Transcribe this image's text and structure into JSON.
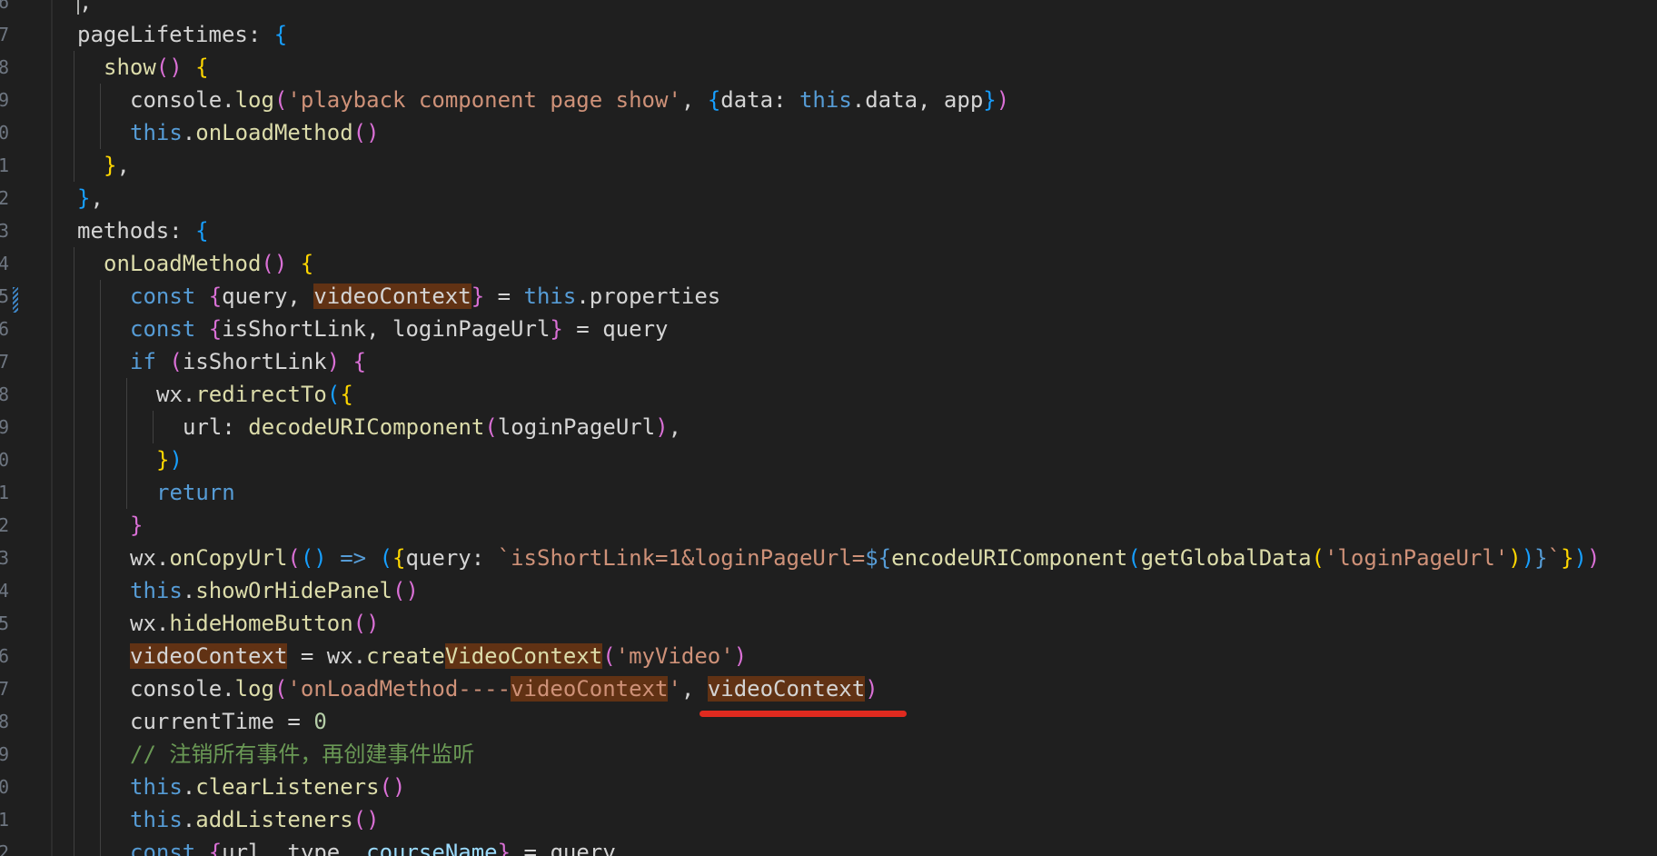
{
  "editor": {
    "language": "javascript",
    "highlight_color": "#613214",
    "annotation_color": "#e02a1f",
    "highlighted_identifier": "videoContext"
  },
  "gutter": {
    "line_number_fragments": [
      "6",
      "7",
      "8",
      "9",
      "0",
      "1",
      "2",
      "3",
      "4",
      "5",
      "6",
      "7",
      "8",
      "9",
      "0",
      "1",
      "2",
      "3",
      "4",
      "5",
      "6",
      "7",
      "8",
      "9",
      "0",
      "1",
      "2"
    ]
  },
  "lines": [
    {
      "t": [
        [
          "cursor",
          ""
        ],
        [
          "p",
          ","
        ]
      ]
    },
    {
      "t": [
        [
          "n",
          "pageLifetimes"
        ],
        [
          "p",
          ": "
        ],
        [
          "b3",
          "{"
        ]
      ]
    },
    {
      "t": [
        [
          "f",
          "show"
        ],
        [
          "b2",
          "()"
        ],
        [
          "p",
          " "
        ],
        [
          "b1",
          "{"
        ]
      ]
    },
    {
      "t": [
        [
          "n",
          "console"
        ],
        [
          "p",
          "."
        ],
        [
          "f",
          "log"
        ],
        [
          "b2",
          "("
        ],
        [
          "s",
          "'playback component page show'"
        ],
        [
          "p",
          ", "
        ],
        [
          "b3",
          "{"
        ],
        [
          "n",
          "data"
        ],
        [
          "p",
          ": "
        ],
        [
          "k",
          "this"
        ],
        [
          "p",
          "."
        ],
        [
          "n",
          "data"
        ],
        [
          "p",
          ", "
        ],
        [
          "n",
          "app"
        ],
        [
          "b3",
          "}"
        ],
        [
          "b2",
          ")"
        ]
      ]
    },
    {
      "t": [
        [
          "k",
          "this"
        ],
        [
          "p",
          "."
        ],
        [
          "f",
          "onLoadMethod"
        ],
        [
          "b2",
          "()"
        ]
      ]
    },
    {
      "t": [
        [
          "b1",
          "}"
        ],
        [
          "p",
          ","
        ]
      ]
    },
    {
      "t": [
        [
          "b3",
          "}"
        ],
        [
          "p",
          ","
        ]
      ]
    },
    {
      "t": [
        [
          "n",
          "methods"
        ],
        [
          "p",
          ": "
        ],
        [
          "b3",
          "{"
        ]
      ]
    },
    {
      "t": [
        [
          "f",
          "onLoadMethod"
        ],
        [
          "b2",
          "()"
        ],
        [
          "p",
          " "
        ],
        [
          "b1",
          "{"
        ]
      ]
    },
    {
      "t": [
        [
          "k",
          "const"
        ],
        [
          "p",
          " "
        ],
        [
          "b2",
          "{"
        ],
        [
          "n",
          "query"
        ],
        [
          "p",
          ", "
        ],
        [
          "hl",
          "videoContext"
        ],
        [
          "b2",
          "}"
        ],
        [
          "p",
          " = "
        ],
        [
          "k",
          "this"
        ],
        [
          "p",
          "."
        ],
        [
          "n",
          "properties"
        ]
      ]
    },
    {
      "t": [
        [
          "k",
          "const"
        ],
        [
          "p",
          " "
        ],
        [
          "b2",
          "{"
        ],
        [
          "n",
          "isShortLink"
        ],
        [
          "p",
          ", "
        ],
        [
          "n",
          "loginPageUrl"
        ],
        [
          "b2",
          "}"
        ],
        [
          "p",
          " = "
        ],
        [
          "n",
          "query"
        ]
      ]
    },
    {
      "t": [
        [
          "k",
          "if"
        ],
        [
          "p",
          " "
        ],
        [
          "b2",
          "("
        ],
        [
          "n",
          "isShortLink"
        ],
        [
          "b2",
          ")"
        ],
        [
          "p",
          " "
        ],
        [
          "b2",
          "{"
        ]
      ]
    },
    {
      "t": [
        [
          "n",
          "wx"
        ],
        [
          "p",
          "."
        ],
        [
          "f",
          "redirectTo"
        ],
        [
          "b3",
          "("
        ],
        [
          "b1",
          "{"
        ]
      ]
    },
    {
      "t": [
        [
          "n",
          "url"
        ],
        [
          "p",
          ": "
        ],
        [
          "f",
          "decodeURIComponent"
        ],
        [
          "b2",
          "("
        ],
        [
          "n",
          "loginPageUrl"
        ],
        [
          "b2",
          ")"
        ],
        [
          "p",
          ","
        ]
      ]
    },
    {
      "t": [
        [
          "b1",
          "}"
        ],
        [
          "b3",
          ")"
        ]
      ]
    },
    {
      "t": [
        [
          "k",
          "return"
        ]
      ]
    },
    {
      "t": [
        [
          "b2",
          "}"
        ]
      ]
    },
    {
      "t": [
        [
          "n",
          "wx"
        ],
        [
          "p",
          "."
        ],
        [
          "f",
          "onCopyUrl"
        ],
        [
          "b2",
          "("
        ],
        [
          "b3",
          "()"
        ],
        [
          "p",
          " "
        ],
        [
          "k",
          "=>"
        ],
        [
          "p",
          " "
        ],
        [
          "b3",
          "("
        ],
        [
          "b1",
          "{"
        ],
        [
          "n",
          "query"
        ],
        [
          "p",
          ": "
        ],
        [
          "s",
          "`isShortLink=1&loginPageUrl="
        ],
        [
          "k",
          "${"
        ],
        [
          "f",
          "encodeURIComponent"
        ],
        [
          "b3",
          "("
        ],
        [
          "f",
          "getGlobalData"
        ],
        [
          "b1",
          "("
        ],
        [
          "s",
          "'loginPageUrl'"
        ],
        [
          "b1",
          ")"
        ],
        [
          "b3",
          ")"
        ],
        [
          "k",
          "}"
        ],
        [
          "s",
          "`"
        ],
        [
          "b1",
          "}"
        ],
        [
          "b3",
          ")"
        ],
        [
          "b2",
          ")"
        ]
      ]
    },
    {
      "t": [
        [
          "k",
          "this"
        ],
        [
          "p",
          "."
        ],
        [
          "f",
          "showOrHidePanel"
        ],
        [
          "b2",
          "()"
        ]
      ]
    },
    {
      "t": [
        [
          "n",
          "wx"
        ],
        [
          "p",
          "."
        ],
        [
          "f",
          "hideHomeButton"
        ],
        [
          "b2",
          "()"
        ]
      ]
    },
    {
      "t": [
        [
          "hl",
          "videoContext"
        ],
        [
          "p",
          " = "
        ],
        [
          "n",
          "wx"
        ],
        [
          "p",
          "."
        ],
        [
          "f",
          "create"
        ],
        [
          "hlf",
          "VideoContext"
        ],
        [
          "b2",
          "("
        ],
        [
          "s",
          "'myVideo'"
        ],
        [
          "b2",
          ")"
        ]
      ]
    },
    {
      "t": [
        [
          "n",
          "console"
        ],
        [
          "p",
          "."
        ],
        [
          "f",
          "log"
        ],
        [
          "b2",
          "("
        ],
        [
          "s",
          "'onLoadMethod----"
        ],
        [
          "hls",
          "videoContext"
        ],
        [
          "s",
          "'"
        ],
        [
          "p",
          ", "
        ],
        [
          "hl",
          "videoContext"
        ],
        [
          "b2",
          ")"
        ]
      ]
    },
    {
      "t": [
        [
          "n",
          "currentTime"
        ],
        [
          "p",
          " = "
        ],
        [
          "num",
          "0"
        ]
      ]
    },
    {
      "t": [
        [
          "c",
          "// 注销所有事件，再创建事件监听"
        ]
      ]
    },
    {
      "t": [
        [
          "k",
          "this"
        ],
        [
          "p",
          "."
        ],
        [
          "f",
          "clearListeners"
        ],
        [
          "b2",
          "()"
        ]
      ]
    },
    {
      "t": [
        [
          "k",
          "this"
        ],
        [
          "p",
          "."
        ],
        [
          "f",
          "addListeners"
        ],
        [
          "b2",
          "()"
        ]
      ]
    },
    {
      "t": [
        [
          "k",
          "const"
        ],
        [
          "p",
          " "
        ],
        [
          "b2",
          "{"
        ],
        [
          "n",
          "url"
        ],
        [
          "p",
          ", "
        ],
        [
          "n",
          "type"
        ],
        [
          "p",
          ", "
        ],
        [
          "v",
          "courseName"
        ],
        [
          "b2",
          "}"
        ],
        [
          "p",
          " = "
        ],
        [
          "n",
          "query"
        ]
      ]
    }
  ]
}
